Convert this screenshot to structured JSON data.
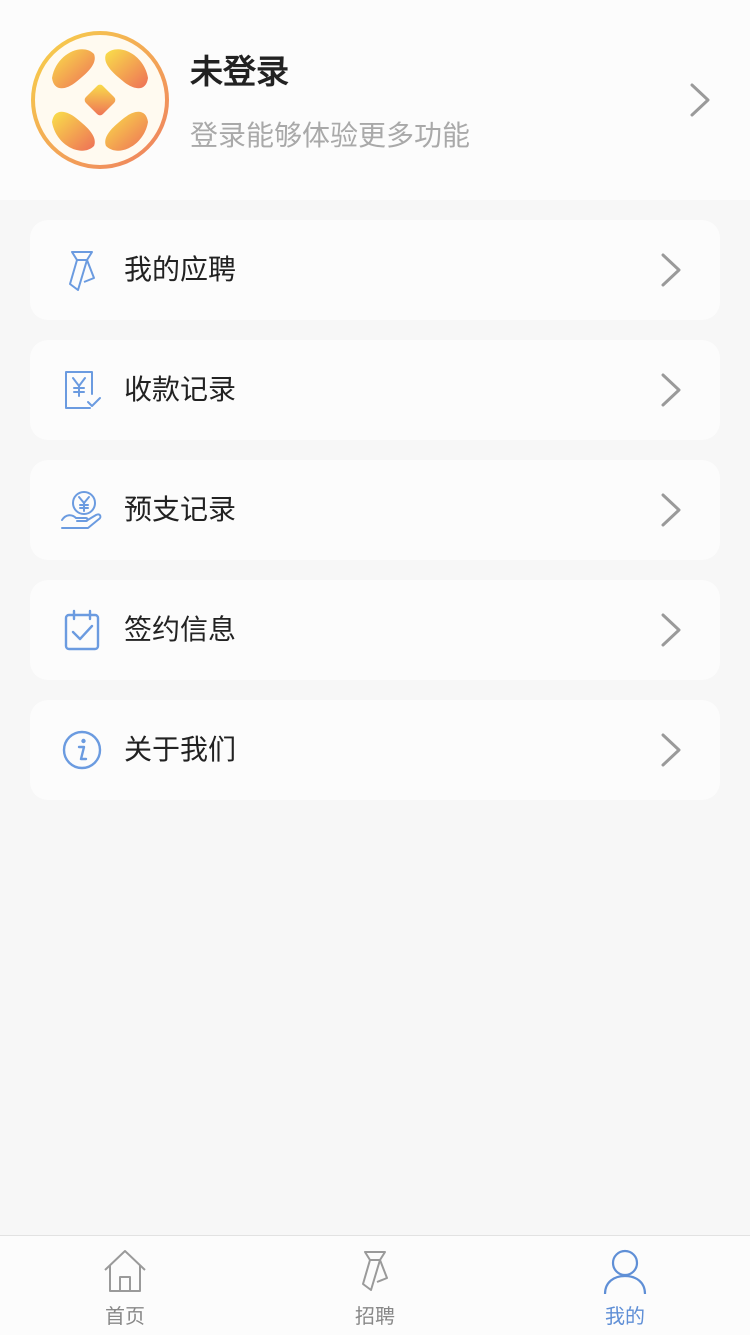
{
  "header": {
    "title": "未登录",
    "subtitle": "登录能够体验更多功能",
    "avatar_icon": "coin-logo-icon",
    "chevron_icon": "chevron-right-icon"
  },
  "menu": [
    {
      "label": "我的应聘",
      "icon": "tie-icon"
    },
    {
      "label": "收款记录",
      "icon": "yuan-receipt-icon"
    },
    {
      "label": "预支记录",
      "icon": "yuan-hand-icon"
    },
    {
      "label": "签约信息",
      "icon": "calendar-check-icon"
    },
    {
      "label": "关于我们",
      "icon": "info-icon"
    }
  ],
  "tabbar": {
    "tabs": [
      {
        "label": "首页",
        "icon": "home-icon",
        "active": false
      },
      {
        "label": "招聘",
        "icon": "tie-icon",
        "active": false
      },
      {
        "label": "我的",
        "icon": "user-icon",
        "active": true
      }
    ]
  },
  "colors": {
    "accent": "#5f8fd6",
    "icon_blue": "#6b9be0",
    "muted_text": "#a9a9a9",
    "tab_inactive": "#888888",
    "background": "#f7f7f7",
    "card": "#fcfcfc"
  }
}
